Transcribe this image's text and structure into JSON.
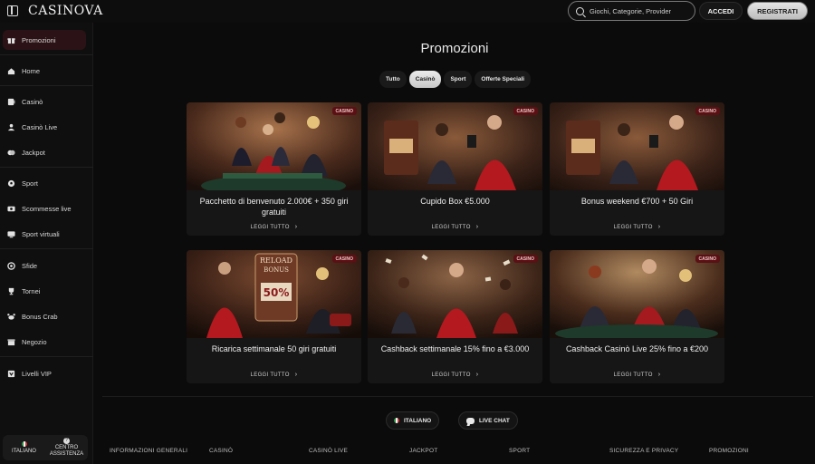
{
  "header": {
    "logo": "CASINOVA",
    "search_placeholder": "Giochi, Categorie, Provider",
    "login_label": "ACCEDI",
    "register_label": "REGISTRATI"
  },
  "sidebar": {
    "items": [
      {
        "label": "Promozioni",
        "icon": "gift-icon"
      },
      {
        "label": "Home",
        "icon": "home-icon"
      },
      {
        "label": "Casinò",
        "icon": "slot-icon"
      },
      {
        "label": "Casinò Live",
        "icon": "dealer-icon"
      },
      {
        "label": "Jackpot",
        "icon": "jackpot-icon"
      },
      {
        "label": "Sport",
        "icon": "ball-icon"
      },
      {
        "label": "Scommesse live",
        "icon": "live-icon"
      },
      {
        "label": "Sport virtuali",
        "icon": "virtual-icon"
      },
      {
        "label": "Sfide",
        "icon": "challenge-icon"
      },
      {
        "label": "Tornei",
        "icon": "trophy-icon"
      },
      {
        "label": "Bonus Crab",
        "icon": "crab-icon"
      },
      {
        "label": "Negozio",
        "icon": "shop-icon"
      },
      {
        "label": "Livelli VIP",
        "icon": "vip-icon"
      }
    ],
    "language_label": "ITALIANO",
    "support_label_1": "CENTRO",
    "support_label_2": "ASSISTENZA"
  },
  "main": {
    "title": "Promozioni",
    "tabs": [
      {
        "label": "Tutto",
        "active": false
      },
      {
        "label": "Casinò",
        "active": true
      },
      {
        "label": "Sport",
        "active": false
      },
      {
        "label": "Offerte Speciali",
        "active": false
      }
    ],
    "cards": [
      {
        "title": "Pacchetto di benvenuto 2.000€ + 350 giri gratuiti",
        "badge": "CASINO",
        "cta": "LEGGI TUTTO"
      },
      {
        "title": "Cupido Box €5.000",
        "badge": "CASINO",
        "cta": "LEGGI TUTTO"
      },
      {
        "title": "Bonus weekend €700 + 50 Giri",
        "badge": "CASINO",
        "cta": "LEGGI TUTTO"
      },
      {
        "title": "Ricarica settimanale 50 giri gratuiti",
        "badge": "CASINO",
        "cta": "LEGGI TUTTO"
      },
      {
        "title": "Cashback settimanale 15% fino a €3.000",
        "badge": "CASINO",
        "cta": "LEGGI TUTTO"
      },
      {
        "title": "Cashback Casinò Live 25% fino a €200",
        "badge": "CASINO",
        "cta": "LEGGI TUTTO"
      }
    ],
    "slot_banner_text_1": "RELOAD",
    "slot_banner_text_2": "BONUS",
    "slot_banner_value": "50%"
  },
  "footer": {
    "language_pill": "ITALIANO",
    "chat_pill": "LIVE CHAT",
    "links": [
      "INFORMAZIONI GENERALI",
      "CASINÒ",
      "CASINÒ LIVE",
      "JACKPOT",
      "SPORT",
      "SICUREZZA E PRIVACY",
      "PROMOZIONI"
    ]
  },
  "colors": {
    "background": "#0b0b0c",
    "sidebar_active": "#2b1216",
    "badge": "#5a1014",
    "accent_red": "#b3191f"
  }
}
